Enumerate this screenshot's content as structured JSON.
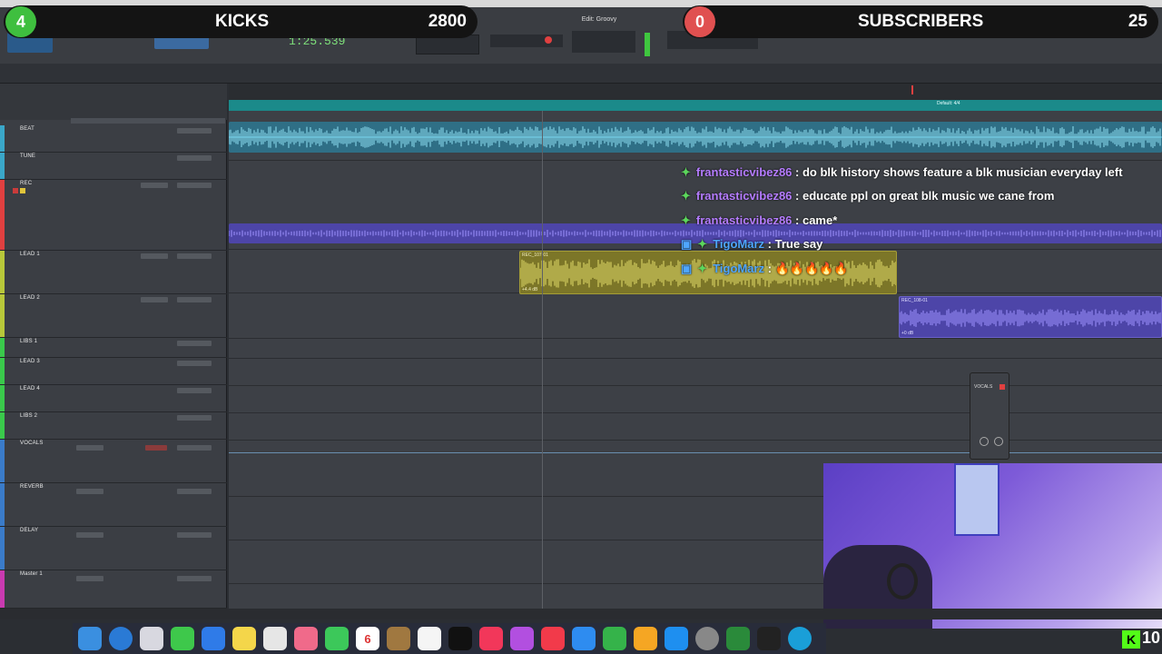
{
  "overlay": {
    "kicks_count": "4",
    "kicks_label": "KICKS",
    "kicks_score": "2800",
    "subs_count": "0",
    "subs_label": "SUBSCRIBERS",
    "subs_score": "25"
  },
  "window_title": "Edit: Groovy",
  "counter_main": "1:25.539",
  "tracks": [
    {
      "name": "BEAT"
    },
    {
      "name": "TUNE"
    },
    {
      "name": "REC"
    },
    {
      "name": "LEAD 1"
    },
    {
      "name": "LEAD 2"
    },
    {
      "name": "LIBS 1"
    },
    {
      "name": "LEAD 3"
    },
    {
      "name": "LEAD 4"
    },
    {
      "name": "LIBS 2"
    },
    {
      "name": "VOCALS"
    },
    {
      "name": "REVERB"
    },
    {
      "name": "DELAY"
    },
    {
      "name": "Master 1"
    }
  ],
  "ruler_label": "Default: 4/4",
  "clips": {
    "rec_clip": "REC_107-01",
    "rec_clip_gain": "+4.4 dB",
    "lead_clip": "REC_108-01",
    "lead_clip_gain": "+0 dB"
  },
  "chat": [
    {
      "user": "frantasticvibez86",
      "text": ": do blk history shows feature a blk musician everyday left"
    },
    {
      "user": "frantasticvibez86",
      "text": ": educate ppl on great blk music we cane from"
    },
    {
      "user": "frantasticvibez86",
      "text": ": came*"
    },
    {
      "user": "TigoMarz",
      "text": ": True say"
    },
    {
      "user": "TigoMarz",
      "text": ": 🔥🔥🔥🔥🔥"
    }
  ],
  "float_window": {
    "title": "VOCALS"
  },
  "dock_date": "6",
  "corner_count": "10",
  "colors": {
    "kicks_badge": "#3fbf3f",
    "subs_badge": "#e05050",
    "tempo_ruler": "#1b8a8a",
    "beat_wave": "#5ec8e6",
    "rec_wave": "#7d6cff",
    "lead_clip": "#d9cf55",
    "chat_user": "#b57cff"
  }
}
